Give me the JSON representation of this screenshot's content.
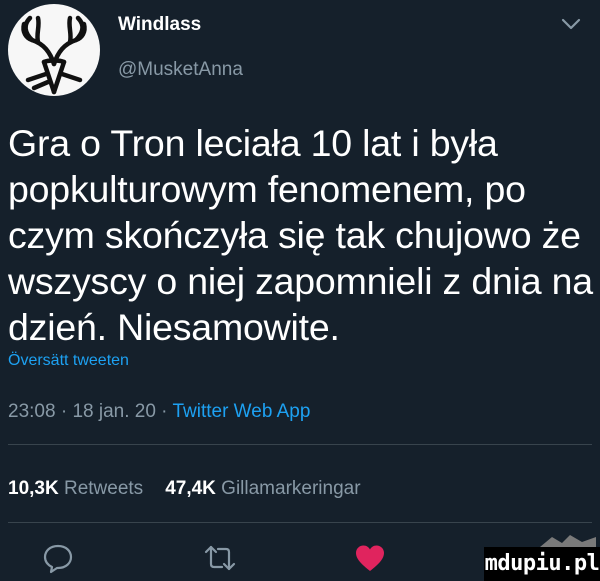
{
  "tweet": {
    "author": {
      "display_name": "Windlass",
      "handle": "@MusketAnna",
      "avatar_icon": "deer-antlers-sketch-icon"
    },
    "menu_icon": "chevron-down-icon",
    "text_lines": [
      "Gra o Tron leciała 10 lat i była",
      "popkulturowym fenomenem, po",
      "czym skończyła się tak chujowo że",
      "wszyscy o niej zapomnieli z dnia na",
      "dzień. Niesamowite."
    ],
    "translate_label": "Översätt tweeten",
    "meta": {
      "time": "23:08",
      "separator": " · ",
      "date": "18 jan. 20",
      "source": "Twitter Web App"
    },
    "stats": {
      "retweets_count": "10,3K",
      "retweets_label": "Retweets",
      "likes_count": "47,4K",
      "likes_label": "Gillamarkeringar"
    },
    "actions": [
      {
        "name": "reply",
        "icon": "speech-bubble-icon"
      },
      {
        "name": "retweet",
        "icon": "retweet-icon"
      },
      {
        "name": "like",
        "icon": "heart-icon",
        "active_color": "#e0245e"
      }
    ]
  },
  "watermark": {
    "text": "mdupiu.pl"
  },
  "colors": {
    "background": "#15202b",
    "text": "#ffffff",
    "secondary": "#8899a6",
    "link": "#1da1f2",
    "divider": "#38444d",
    "like": "#e0245e"
  }
}
